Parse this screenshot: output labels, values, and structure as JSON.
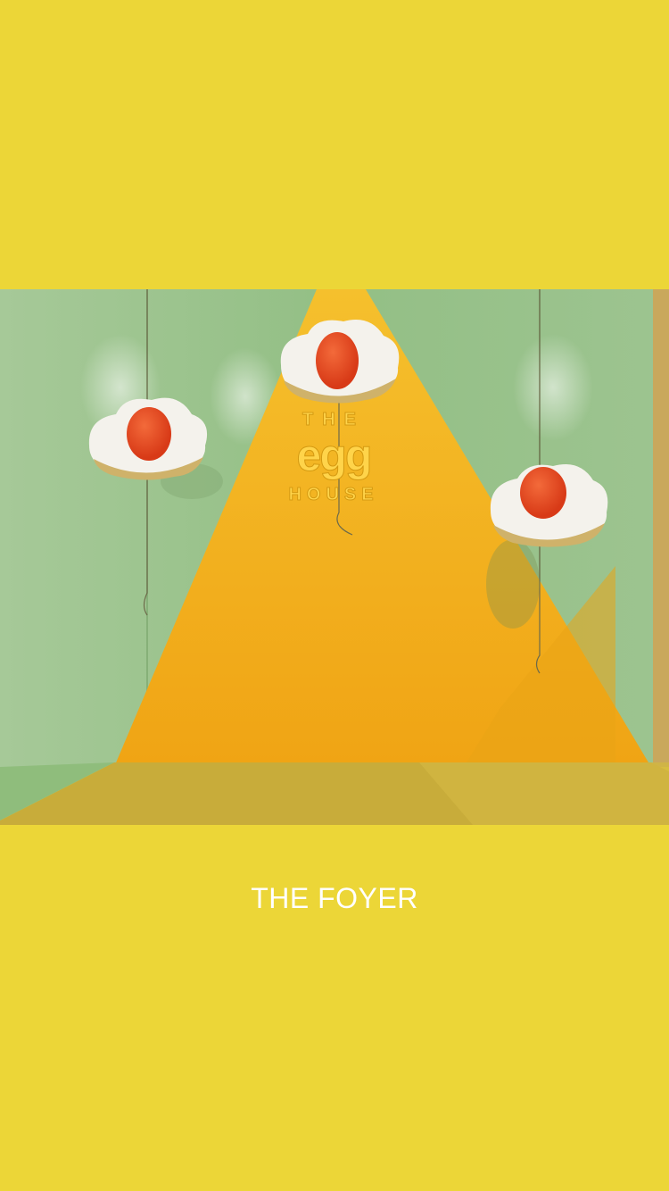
{
  "scene": {
    "sign_line1": "THE",
    "sign_line2": "egg",
    "sign_line3": "HOUSE",
    "alt": "Foyer with yellow spotlight wall and cloud egg lamps"
  },
  "caption": "THE FOYER",
  "colors": {
    "page_background": "#ecd637",
    "wall": "#9cc48e",
    "spotlight": "#f3ad1c",
    "floor": "#c9ad3a",
    "yolk": "#e8461f",
    "caption_text": "#ffffff"
  }
}
